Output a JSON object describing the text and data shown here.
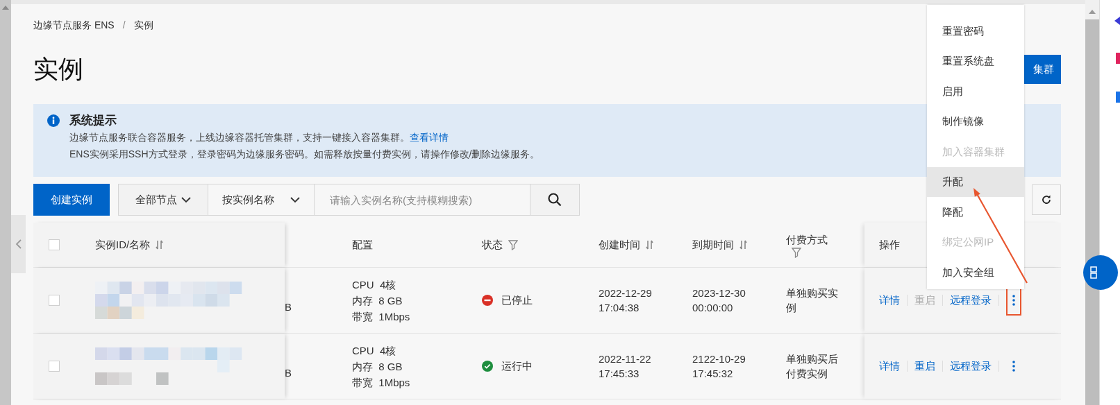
{
  "breadcrumb": {
    "items": [
      {
        "label": "边缘节点服务 ENS"
      },
      {
        "label": "实例"
      }
    ],
    "separator": "/"
  },
  "page_title": "实例",
  "create_cluster_button": "集群",
  "notice": {
    "title": "系统提示",
    "lines": [
      {
        "text": "边缘节点服务联合容器服务，上线边缘容器托管集群，支持一键接入容器集群。",
        "link": "查看详情"
      },
      {
        "text": "ENS实例采用SSH方式登录，登录密码为边缘服务密码。如需释放按量付费实例，请操作修改/删除边缘服务。"
      }
    ]
  },
  "toolbar": {
    "create_button": "创建实例",
    "node_select": "全部节点",
    "search_type_select": "按实例名称",
    "search_placeholder": "请输入实例名称(支持模糊搜索)"
  },
  "table": {
    "header_checked": false,
    "columns": [
      {
        "label": "实例ID/名称",
        "kind": "sort"
      },
      {
        "label": "配置",
        "kind": "plain"
      },
      {
        "label": "状态",
        "kind": "filter"
      },
      {
        "label": "创建时间",
        "kind": "sort"
      },
      {
        "label": "到期时间",
        "kind": "sort"
      },
      {
        "label": "付费方式",
        "kind": "filter"
      },
      {
        "label": "操作",
        "kind": "plain"
      }
    ],
    "rows": [
      {
        "checked": false,
        "column_2": "B",
        "config": [
          "CPU  4核",
          "内存  8 GB",
          "带宽  1Mbps"
        ],
        "status": {
          "kind": "stopped",
          "label": "已停止"
        },
        "created": [
          "2022-12-29",
          "17:04:38"
        ],
        "expires": [
          "2023-12-30",
          "00:00:00"
        ],
        "billing": "单独购买实例",
        "actions": [
          {
            "label": "详情",
            "disabled": false
          },
          {
            "label": "重启",
            "disabled": true
          },
          {
            "label": "远程登录",
            "disabled": false
          }
        ],
        "menu_open": true
      },
      {
        "checked": false,
        "column_2": "B",
        "config": [
          "CPU  4核",
          "内存  8 GB",
          "带宽  1Mbps"
        ],
        "status": {
          "kind": "running",
          "label": "运行中"
        },
        "created": [
          "2022-11-22",
          "17:45:33"
        ],
        "expires": [
          "2122-10-29",
          "17:45:32"
        ],
        "billing": "单独购买后付费实例",
        "actions": [
          {
            "label": "详情",
            "disabled": false
          },
          {
            "label": "重启",
            "disabled": false
          },
          {
            "label": "远程登录",
            "disabled": false
          }
        ],
        "menu_open": false
      }
    ]
  },
  "action_menu": {
    "items": [
      {
        "label": "重置密码",
        "disabled": false,
        "selected": false
      },
      {
        "label": "重置系统盘",
        "disabled": false,
        "selected": false
      },
      {
        "label": "启用",
        "disabled": false,
        "selected": false
      },
      {
        "label": "制作镜像",
        "disabled": false,
        "selected": false
      },
      {
        "label": "加入容器集群",
        "disabled": true,
        "selected": false
      },
      {
        "label": "升配",
        "disabled": false,
        "selected": true
      },
      {
        "label": "降配",
        "disabled": false,
        "selected": false
      },
      {
        "label": "绑定公网IP",
        "disabled": true,
        "selected": false
      },
      {
        "label": "加入安全组",
        "disabled": false,
        "selected": false
      }
    ]
  }
}
